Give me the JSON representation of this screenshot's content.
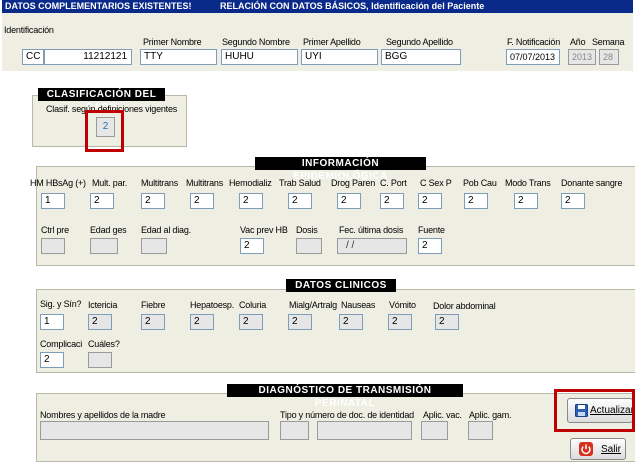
{
  "top": {
    "title1": "DATOS COMPLEMENTARIOS EXISTENTES!",
    "title2": "RELACIÓN CON DATOS BÁSICOS, Identificación del Paciente",
    "labels": {
      "ident": "Identificación",
      "nombre1": "Primer Nombre",
      "nombre2": "Segundo Nombre",
      "apellido1": "Primer Apellido",
      "apellido2": "Segundo Apellido",
      "fnotif": "F. Notificación",
      "anio": "Año",
      "semana": "Semana"
    },
    "values": {
      "tipo": "CC",
      "numero": "11212121",
      "nombre1": "TTY",
      "nombre2": "HUHU",
      "apellido1": "UYI",
      "apellido2": "BGG",
      "fnotif": "07/07/2013",
      "anio": "2013",
      "semana": "28"
    }
  },
  "clasificacion": {
    "title": "CLASIFICACIÓN DEL CASO",
    "label": "Clasif. según definiciones vigentes",
    "value": "2"
  },
  "epidemio": {
    "title": "INFORMACIÓN EPIDEMIOLÓGICA",
    "labels": [
      "HM HBsAg (+)",
      "Mult. par.",
      "Multitrans",
      "Multitrans",
      "Hemodializ",
      "Trab Salud",
      "Drog Paren",
      "C. Port",
      "C Sex P",
      "Pob Cau",
      "Modo Trans",
      "Donante sangre"
    ],
    "values": [
      "1",
      "2",
      "2",
      "2",
      "2",
      "2",
      "2",
      "2",
      "2",
      "2",
      "2",
      "2"
    ],
    "row2": {
      "ctrl_pre": "Ctrl pre",
      "edad_ges": "Edad ges",
      "edad_diag": "Edad al diag.",
      "vac_prev": "Vac prev HB",
      "vac_prev_value": "2",
      "dosis": "Dosis",
      "fec_ultima": "Fec. última dosis",
      "fec_ultima_value": "/ /",
      "fuente": "Fuente",
      "fuente_value": "2"
    }
  },
  "clinicos": {
    "title": "DATOS CLINICOS",
    "labels": [
      "Sig. y Sín?",
      "Ictericia",
      "Fiebre",
      "Hepatoesp.",
      "Coluria",
      "Mialg/Artralg",
      "Nauseas",
      "Vómito",
      "Dolor abdominal"
    ],
    "values": [
      "1",
      "2",
      "2",
      "2",
      "2",
      "2",
      "2",
      "2",
      "2"
    ],
    "complicaciones": "Complicaci",
    "complicaciones_value": "2",
    "cuales": "Cuáles?"
  },
  "perinatal": {
    "title": "DIAGNÓSTICO DE TRANSMISIÓN PERINATAL",
    "madre": "Nombres y apellidos de la madre",
    "tipo_doc": "Tipo y número de doc. de identidad",
    "aplic_vac": "Aplic. vac.",
    "aplic_gam": "Aplic. gam."
  },
  "buttons": {
    "actualizar": "Actualizar",
    "salir": "Salir"
  },
  "colors": {
    "title_bar": "#0a2a8a",
    "panel": "#eeeee2",
    "highlight": "#c00000"
  }
}
